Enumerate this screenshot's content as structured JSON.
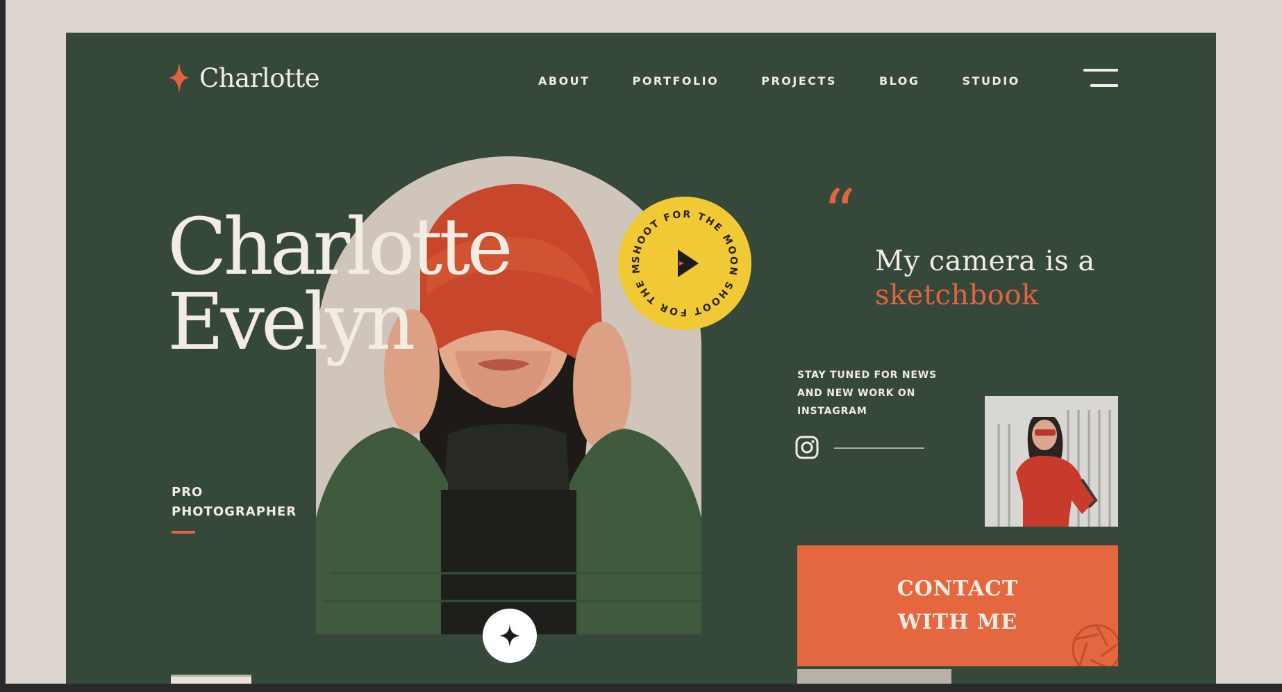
{
  "brand": {
    "name": "Charlotte",
    "accent": "#e0643f",
    "background": "#36483a",
    "highlight": "#f1c935"
  },
  "nav": {
    "items": [
      "ABOUT",
      "PORTFOLIO",
      "PROJECTS",
      "BLOG",
      "STUDIO"
    ]
  },
  "hero": {
    "name_line1": "Charlotte",
    "name_line2": "Evelyn",
    "role_line1": "PRO",
    "role_line2": "PHOTOGRAPHER",
    "badge_text": "SHOOT FOR THE MOON SHOOT FOR THE MOON"
  },
  "quote": {
    "mark": "“",
    "text_line1": "My camera is a",
    "text_accent": "sketchbook"
  },
  "social": {
    "line1": "STAY TUNED FOR NEWS",
    "line2": "AND NEW WORK ON",
    "line3": "INSTAGRAM",
    "icon": "instagram-icon"
  },
  "contact": {
    "line1": "CONTACT",
    "line2": "WITH ME"
  }
}
